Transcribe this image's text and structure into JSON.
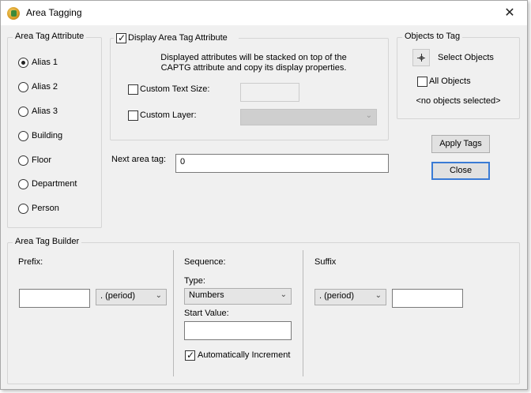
{
  "window": {
    "title": "Area Tagging"
  },
  "area_tag_attribute": {
    "label": "Area Tag Attribute",
    "options": [
      {
        "label": "Alias 1",
        "checked": true
      },
      {
        "label": "Alias 2",
        "checked": false
      },
      {
        "label": "Alias 3",
        "checked": false
      },
      {
        "label": "Building",
        "checked": false
      },
      {
        "label": "Floor",
        "checked": false
      },
      {
        "label": "Department",
        "checked": false
      },
      {
        "label": "Person",
        "checked": false
      }
    ]
  },
  "display": {
    "label": "Display Area Tag Attribute",
    "checked": true,
    "description_line1": "Displayed attributes will be stacked on top of the",
    "description_line2": "CAPTG attribute and copy its display properties.",
    "custom_text_size_label": "Custom Text Size:",
    "custom_text_size_value": "",
    "custom_layer_label": "Custom Layer:",
    "custom_layer_value": ""
  },
  "next_tag": {
    "label": "Next area tag:",
    "value": "0"
  },
  "objects": {
    "label": "Objects to Tag",
    "select_label": "Select Objects",
    "all_label": "All Objects",
    "status": "<no objects selected>"
  },
  "buttons": {
    "apply": "Apply Tags",
    "close": "Close"
  },
  "builder": {
    "label": "Area Tag Builder",
    "prefix_label": "Prefix:",
    "prefix_value": "",
    "prefix_sep": ". (period)",
    "sequence_label": "Sequence:",
    "type_label": "Type:",
    "type_value": "Numbers",
    "start_label": "Start Value:",
    "start_value": "",
    "auto_label": "Automatically Increment",
    "suffix_label": "Suffix",
    "suffix_sep": ". (period)",
    "suffix_value": ""
  }
}
